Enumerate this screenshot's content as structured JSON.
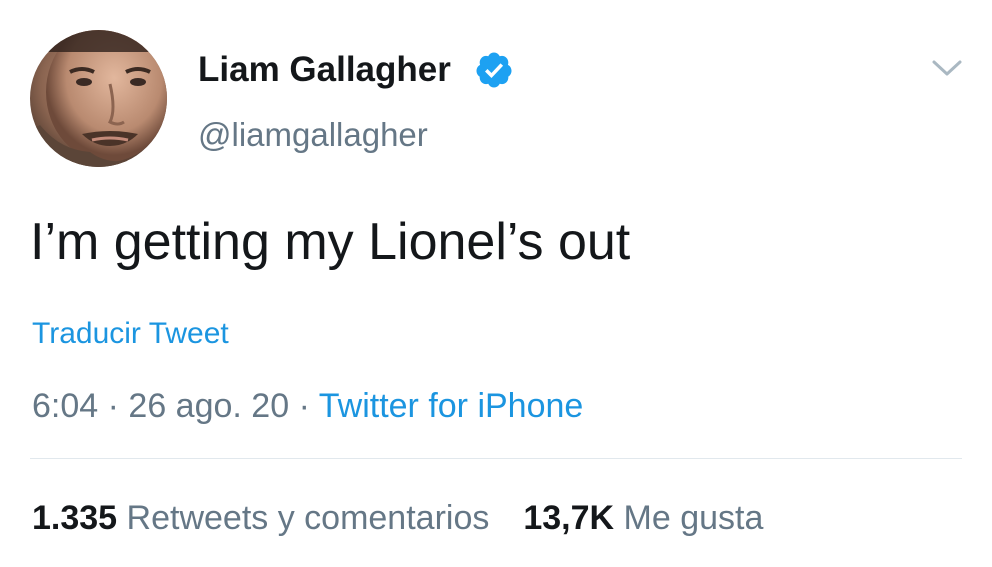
{
  "author": {
    "display_name": "Liam Gallagher",
    "handle": "@liamgallagher",
    "verified": true,
    "avatar_icon": "avatar-photo"
  },
  "tweet": {
    "text": "I’m getting my Lionel’s out",
    "translate_label": "Traducir Tweet",
    "time": "6:04",
    "date": "26 ago. 20",
    "separator": "·",
    "source": "Twitter for iPhone"
  },
  "stats": {
    "retweets_count": "1.335",
    "retweets_label": "Retweets y comentarios",
    "likes_count": "13,7K",
    "likes_label": "Me gusta"
  },
  "colors": {
    "text": "#14171a",
    "secondary": "#657786",
    "link": "#1b95e0",
    "verified": "#1da1f2",
    "divider": "#e1e8ed"
  },
  "icons": {
    "verified": "verified-badge-icon",
    "menu": "chevron-down-icon"
  }
}
